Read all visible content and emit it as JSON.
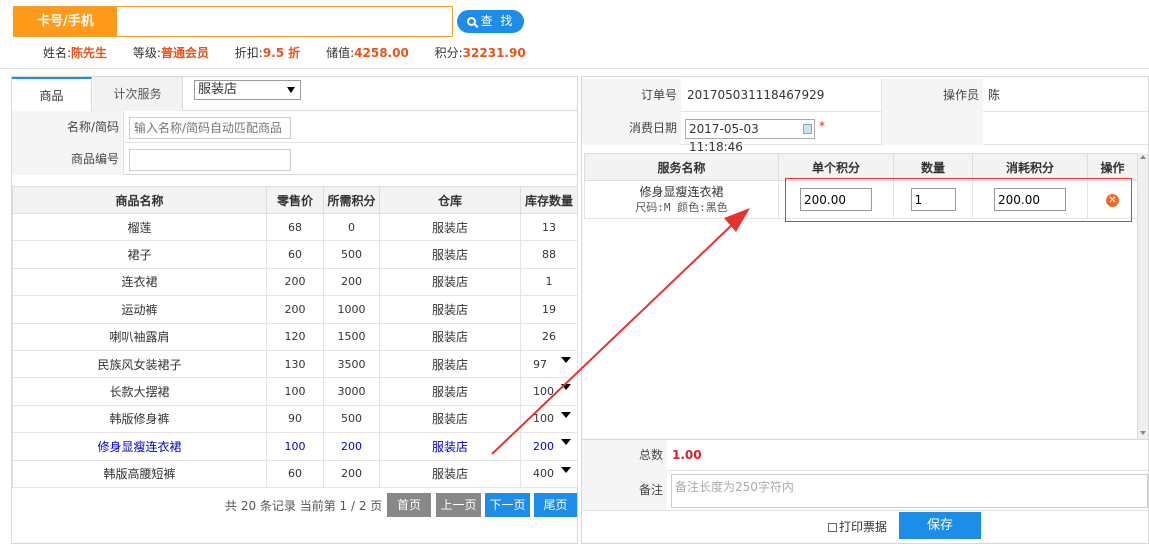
{
  "search": {
    "card_label": "卡号/手机",
    "button_label": "查 找"
  },
  "member": {
    "name_label": "姓名:",
    "name": "陈先生",
    "level_label": "等级:",
    "level": "普通会员",
    "discount_label": "折扣:",
    "discount": "9.5 折",
    "balance_label": "储值:",
    "balance": "4258.00",
    "points_label": "积分:",
    "points": "32231.90"
  },
  "left": {
    "tabs": [
      "商品",
      "计次服务"
    ],
    "store_select": "服装店",
    "filter": {
      "name_label": "名称/简码",
      "name_placeholder": "输入名称/简码自动匹配商品",
      "code_label": "商品编号"
    },
    "table": {
      "headers": [
        "商品名称",
        "零售价",
        "所需积分",
        "仓库",
        "库存数量"
      ],
      "rows": [
        [
          "榴莲",
          "68",
          "0",
          "服装店",
          "13"
        ],
        [
          "裙子",
          "60",
          "500",
          "服装店",
          "88"
        ],
        [
          "连衣裙",
          "200",
          "200",
          "服装店",
          "1"
        ],
        [
          "运动裤",
          "200",
          "1000",
          "服装店",
          "19"
        ],
        [
          "喇叭袖露肩",
          "120",
          "1500",
          "服装店",
          "26"
        ],
        [
          "民族风女装裙子",
          "130",
          "3500",
          "服装店",
          "97"
        ],
        [
          "长款大摆裙",
          "100",
          "3000",
          "服装店",
          "100"
        ],
        [
          "韩版修身裤",
          "90",
          "500",
          "服装店",
          "100"
        ],
        [
          "修身显瘦连衣裙",
          "100",
          "200",
          "服装店",
          "200"
        ],
        [
          "韩版高腰短裤",
          "60",
          "200",
          "服装店",
          "400"
        ]
      ]
    },
    "pager": {
      "info": "共 20 条记录 当前第 1 / 2 页",
      "first": "首页",
      "prev": "上一页",
      "next": "下一页",
      "last": "尾页"
    }
  },
  "right": {
    "order_label": "订单号",
    "order_no": "201705031118467929",
    "operator_label": "操作员",
    "operator": "陈",
    "date_label": "消费日期",
    "date": "2017-05-03 11:18:46",
    "required_mark": "*",
    "service_table": {
      "headers": [
        "服务名称",
        "单个积分",
        "数量",
        "消耗积分",
        "操作"
      ],
      "row": {
        "name": "修身显瘦连衣裙",
        "spec": "尺码:M 颜色:黑色",
        "unit_points": "200.00",
        "qty": "1",
        "total_points": "200.00"
      }
    },
    "total_label": "总数",
    "total": "1.00",
    "remark_label": "备注",
    "remark_placeholder": "备注长度为250字符内",
    "print_label": "打印票据",
    "save_label": "保存"
  },
  "colors": {
    "orange": "#ff9a1a",
    "blue": "#1e8de8",
    "red": "#e33333",
    "value": "#e8541a"
  }
}
